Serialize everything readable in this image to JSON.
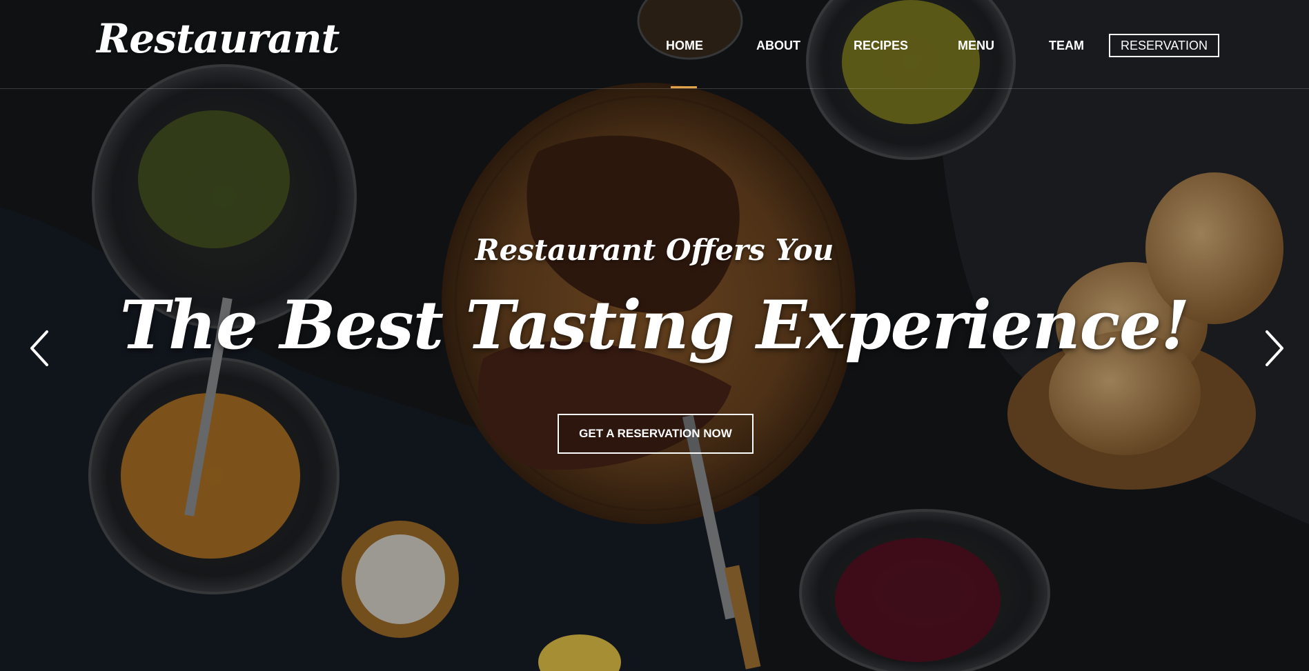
{
  "brand": {
    "logo_text": "Restaurant"
  },
  "nav": {
    "items": [
      {
        "label": "HOME",
        "active": true
      },
      {
        "label": "ABOUT"
      },
      {
        "label": "RECIPES"
      },
      {
        "label": "MENU"
      },
      {
        "label": "TEAM"
      }
    ],
    "reservation_label": "RESERVATION"
  },
  "hero": {
    "subtitle": "Restaurant Offers You",
    "headline": "The Best Tasting Experience!",
    "cta_label": "GET A RESERVATION NOW"
  },
  "colors": {
    "accent": "#e0a24a",
    "text": "#ffffff",
    "background": "#15171a"
  },
  "icons": {
    "prev": "chevron-left-icon",
    "next": "chevron-right-icon"
  }
}
